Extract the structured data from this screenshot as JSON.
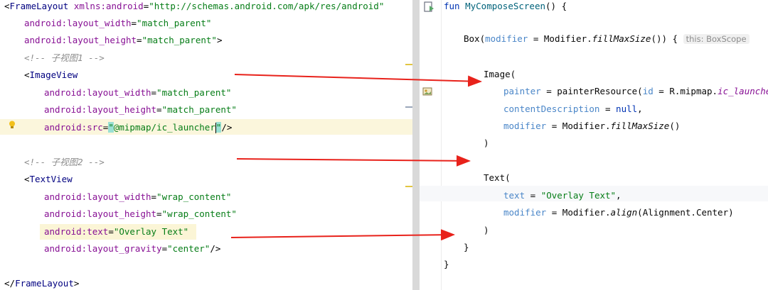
{
  "left": {
    "lines": [
      {
        "id": "frame-open",
        "parts": [
          [
            "punc",
            "<"
          ],
          [
            "tag",
            "FrameLayout "
          ],
          [
            "attr",
            "xmlns:android"
          ],
          [
            "punc",
            "="
          ],
          [
            "val",
            "\"http://schemas.android.com/apk/res/android\""
          ]
        ]
      },
      {
        "id": "fl-width",
        "parts": [
          [
            "attr",
            "android:layout_width"
          ],
          [
            "punc",
            "="
          ],
          [
            "val",
            "\"match_parent\""
          ]
        ]
      },
      {
        "id": "fl-height",
        "parts": [
          [
            "attr",
            "android:layout_height"
          ],
          [
            "punc",
            "="
          ],
          [
            "val",
            "\"match_parent\""
          ],
          [
            "punc",
            ">"
          ]
        ]
      },
      {
        "id": "comment-1",
        "parts": [
          [
            "cmt",
            "<!-- 子视图1 -->"
          ]
        ]
      },
      {
        "id": "imageview-open",
        "parts": [
          [
            "punc",
            "<"
          ],
          [
            "tag",
            "ImageView"
          ]
        ]
      },
      {
        "id": "iv-width",
        "parts": [
          [
            "attr",
            "android:layout_width"
          ],
          [
            "punc",
            "="
          ],
          [
            "val",
            "\"match_parent\""
          ]
        ]
      },
      {
        "id": "iv-height",
        "parts": [
          [
            "attr",
            "android:layout_height"
          ],
          [
            "punc",
            "="
          ],
          [
            "val",
            "\"match_parent\""
          ]
        ]
      },
      {
        "id": "iv-src",
        "parts": [
          [
            "attr",
            "android:src"
          ],
          [
            "punc",
            "="
          ],
          [
            "val",
            "\"@mipmap/ic_launcher\""
          ],
          [
            "punc",
            "/>"
          ]
        ]
      },
      {
        "id": "comment-2",
        "parts": [
          [
            "cmt",
            "<!-- 子视图2 -->"
          ]
        ]
      },
      {
        "id": "textview-open",
        "parts": [
          [
            "punc",
            "<"
          ],
          [
            "tag",
            "TextView"
          ]
        ]
      },
      {
        "id": "tv-width",
        "parts": [
          [
            "attr",
            "android:layout_width"
          ],
          [
            "punc",
            "="
          ],
          [
            "val",
            "\"wrap_content\""
          ]
        ]
      },
      {
        "id": "tv-height",
        "parts": [
          [
            "attr",
            "android:layout_height"
          ],
          [
            "punc",
            "="
          ],
          [
            "val",
            "\"wrap_content\""
          ]
        ]
      },
      {
        "id": "tv-text",
        "parts": [
          [
            "attr",
            "android:text"
          ],
          [
            "punc",
            "="
          ],
          [
            "val",
            "\"Overlay Text\""
          ]
        ]
      },
      {
        "id": "tv-gravity",
        "parts": [
          [
            "attr",
            "android:layout_gravity"
          ],
          [
            "punc",
            "="
          ],
          [
            "val",
            "\"center\""
          ],
          [
            "punc",
            "/>"
          ]
        ]
      },
      {
        "id": "frame-close",
        "parts": [
          [
            "punc",
            "</"
          ],
          [
            "tag",
            "FrameLayout"
          ],
          [
            "punc",
            ">"
          ]
        ]
      }
    ]
  },
  "right": {
    "lines": [
      {
        "id": "fun-decl",
        "parts": [
          [
            "kw",
            "fun "
          ],
          [
            "fn",
            "MyComposeScreen"
          ],
          [
            "plain",
            "() {"
          ]
        ]
      },
      {
        "id": "box-call",
        "parts": [
          [
            "plain",
            "Box("
          ],
          [
            "param",
            "modifier"
          ],
          [
            "plain",
            " = Modifier."
          ],
          [
            "ital",
            "fillMaxSize"
          ],
          [
            "plain",
            "()) { "
          ],
          [
            "hint",
            "this: BoxScope"
          ]
        ]
      },
      {
        "id": "image-call",
        "parts": [
          [
            "plain",
            "Image("
          ]
        ]
      },
      {
        "id": "painter-arg",
        "parts": [
          [
            "param",
            "painter"
          ],
          [
            "plain",
            " = painterResource("
          ],
          [
            "param",
            "id"
          ],
          [
            "plain",
            " = R.mipmap."
          ],
          [
            "member",
            "ic_launcher"
          ],
          [
            "plain",
            "),"
          ]
        ]
      },
      {
        "id": "desc-arg",
        "parts": [
          [
            "param",
            "contentDescription"
          ],
          [
            "plain",
            " = "
          ],
          [
            "kw",
            "null"
          ],
          [
            "plain",
            ","
          ]
        ]
      },
      {
        "id": "img-modifier-arg",
        "parts": [
          [
            "param",
            "modifier"
          ],
          [
            "plain",
            " = Modifier."
          ],
          [
            "ital",
            "fillMaxSize"
          ],
          [
            "plain",
            "()"
          ]
        ]
      },
      {
        "id": "image-close",
        "parts": [
          [
            "plain",
            ")"
          ]
        ]
      },
      {
        "id": "text-call",
        "parts": [
          [
            "plain",
            "Text("
          ]
        ]
      },
      {
        "id": "text-arg",
        "parts": [
          [
            "param",
            "text"
          ],
          [
            "plain",
            " = "
          ],
          [
            "val",
            "\"Overlay Text\""
          ],
          [
            "plain",
            ","
          ]
        ]
      },
      {
        "id": "text-modifier-arg",
        "parts": [
          [
            "param",
            "modifier"
          ],
          [
            "plain",
            " = Modifier."
          ],
          [
            "ital",
            "align"
          ],
          [
            "plain",
            "(Alignment.Center)"
          ]
        ]
      },
      {
        "id": "text-close",
        "parts": [
          [
            "plain",
            ")"
          ]
        ]
      },
      {
        "id": "box-close",
        "parts": [
          [
            "plain",
            "}"
          ]
        ]
      },
      {
        "id": "fun-close",
        "parts": [
          [
            "plain",
            "}"
          ]
        ]
      }
    ]
  },
  "colors": {
    "arrow": "#e8221b",
    "caret_line_highlight": "#fbf6dc",
    "tv_text_line_highlight": "#fbf5d6"
  },
  "icons": {
    "intention_bulb": "lightbulb-icon",
    "run_gutter": "run-preview-icon",
    "gutter_preview": "image-preview-icon"
  }
}
